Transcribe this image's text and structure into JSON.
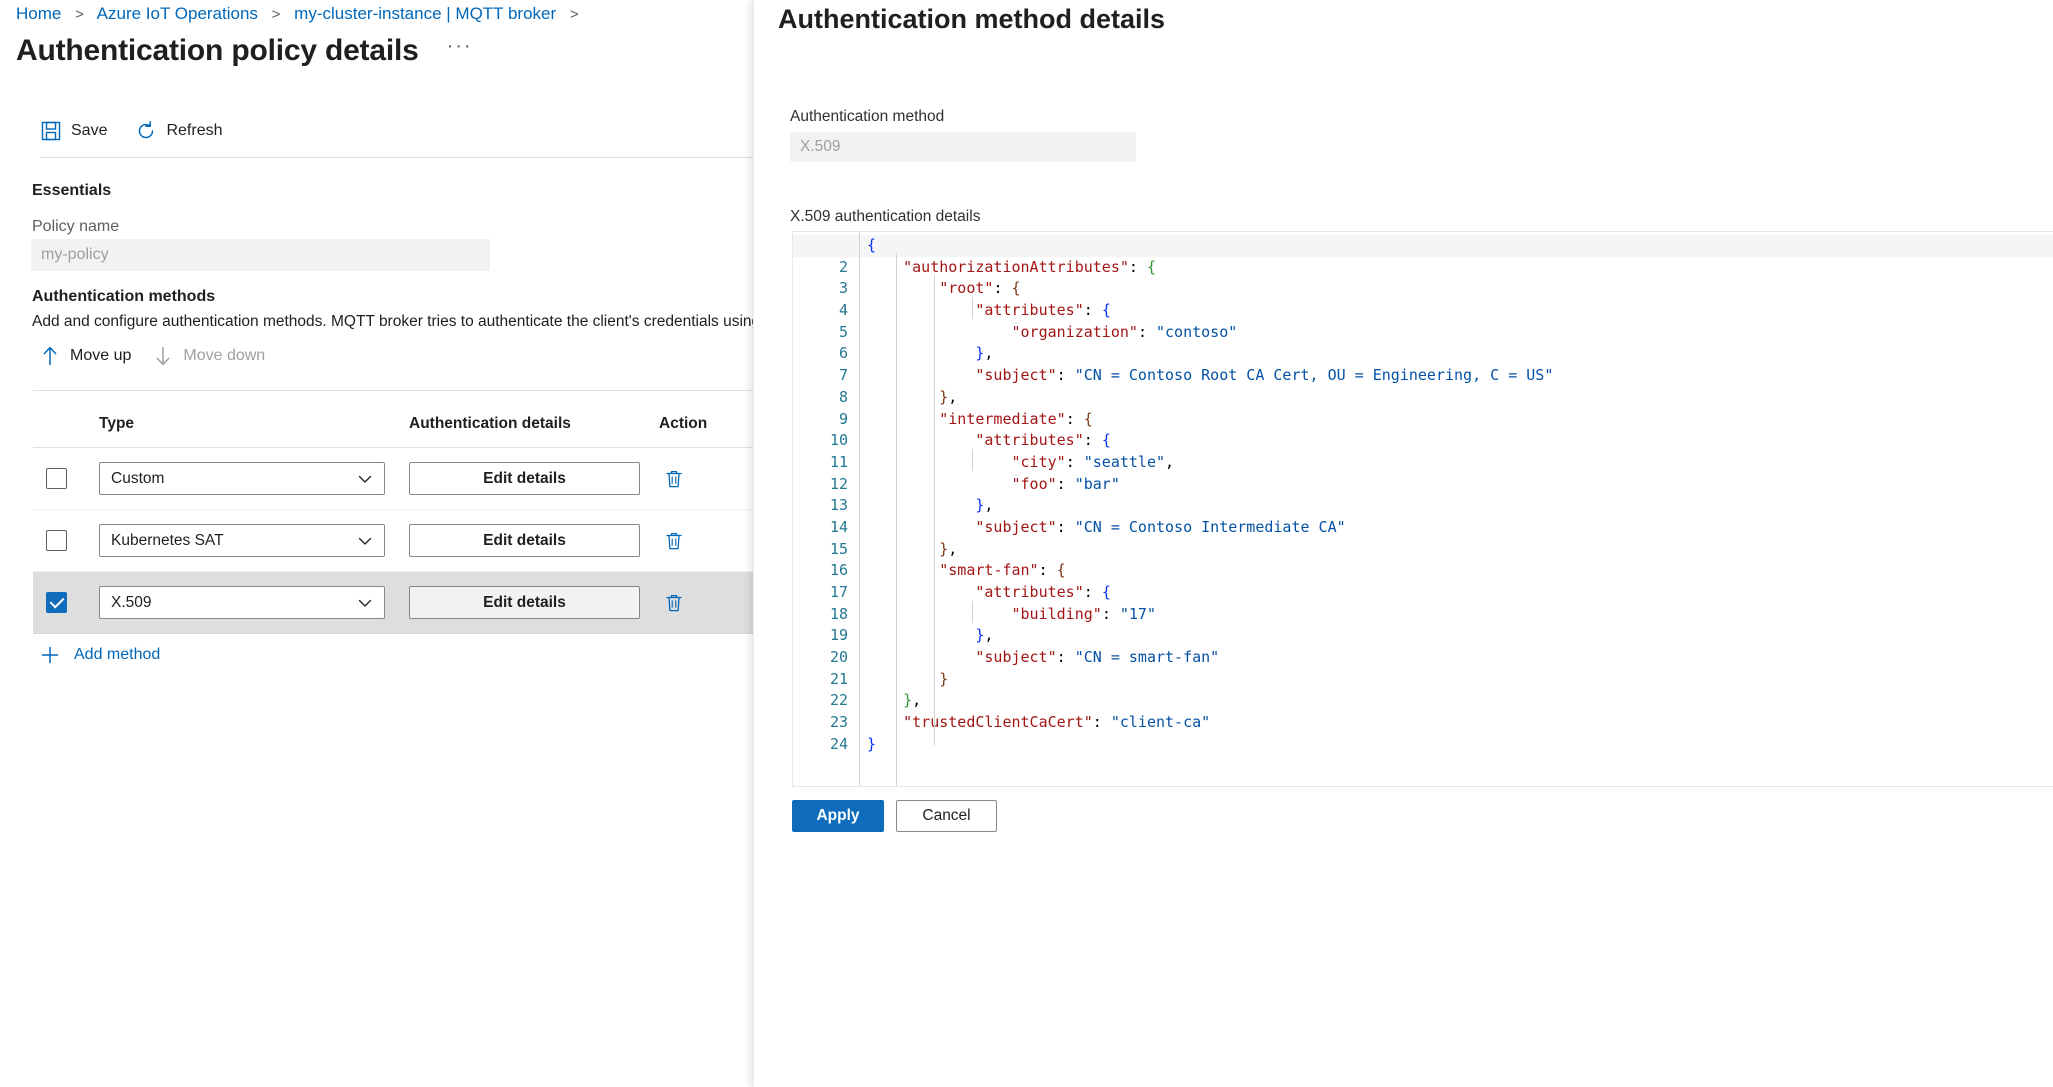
{
  "breadcrumb": {
    "items": [
      "Home",
      "Azure IoT Operations",
      "my-cluster-instance | MQTT broker"
    ],
    "separator": ">"
  },
  "page": {
    "title": "Authentication policy details",
    "more_label": "···"
  },
  "command_bar": {
    "save_label": "Save",
    "refresh_label": "Refresh"
  },
  "essentials": {
    "heading": "Essentials",
    "policy_name_label": "Policy name",
    "policy_name_value": "my-policy"
  },
  "auth_methods": {
    "heading": "Authentication methods",
    "description": "Add and configure authentication methods. MQTT broker tries to authenticate the client's credentials using the",
    "move_up_label": "Move up",
    "move_down_label": "Move down",
    "add_method_label": "Add method",
    "columns": [
      "",
      "Type",
      "Authentication details",
      "Action"
    ],
    "rows": [
      {
        "checked": false,
        "type": "Custom",
        "edit_label": "Edit details"
      },
      {
        "checked": false,
        "type": "Kubernetes SAT",
        "edit_label": "Edit details"
      },
      {
        "checked": true,
        "type": "X.509",
        "edit_label": "Edit details"
      }
    ]
  },
  "flyout": {
    "title": "Authentication method details",
    "auth_method_label": "Authentication method",
    "auth_method_value": "X.509",
    "code_label": "X.509 authentication details",
    "apply_label": "Apply",
    "cancel_label": "Cancel",
    "code_lines": [
      "{",
      "    \"authorizationAttributes\": {",
      "        \"root\": {",
      "            \"attributes\": {",
      "                \"organization\": \"contoso\"",
      "            },",
      "            \"subject\": \"CN = Contoso Root CA Cert, OU = Engineering, C = US\"",
      "        },",
      "        \"intermediate\": {",
      "            \"attributes\": {",
      "                \"city\": \"seattle\",",
      "                \"foo\": \"bar\"",
      "            },",
      "            \"subject\": \"CN = Contoso Intermediate CA\"",
      "        },",
      "        \"smart-fan\": {",
      "            \"attributes\": {",
      "                \"building\": \"17\"",
      "            },",
      "            \"subject\": \"CN = smart-fan\"",
      "        }",
      "    },",
      "    \"trustedClientCaCert\": \"client-ca\"",
      "}"
    ],
    "line_count": 24,
    "current_line": 1
  },
  "colors": {
    "link": "#0067b8",
    "accent": "#0f6cbd",
    "selected_row": "#dededf",
    "json_key": "#a31515",
    "json_string": "#0451a5"
  }
}
